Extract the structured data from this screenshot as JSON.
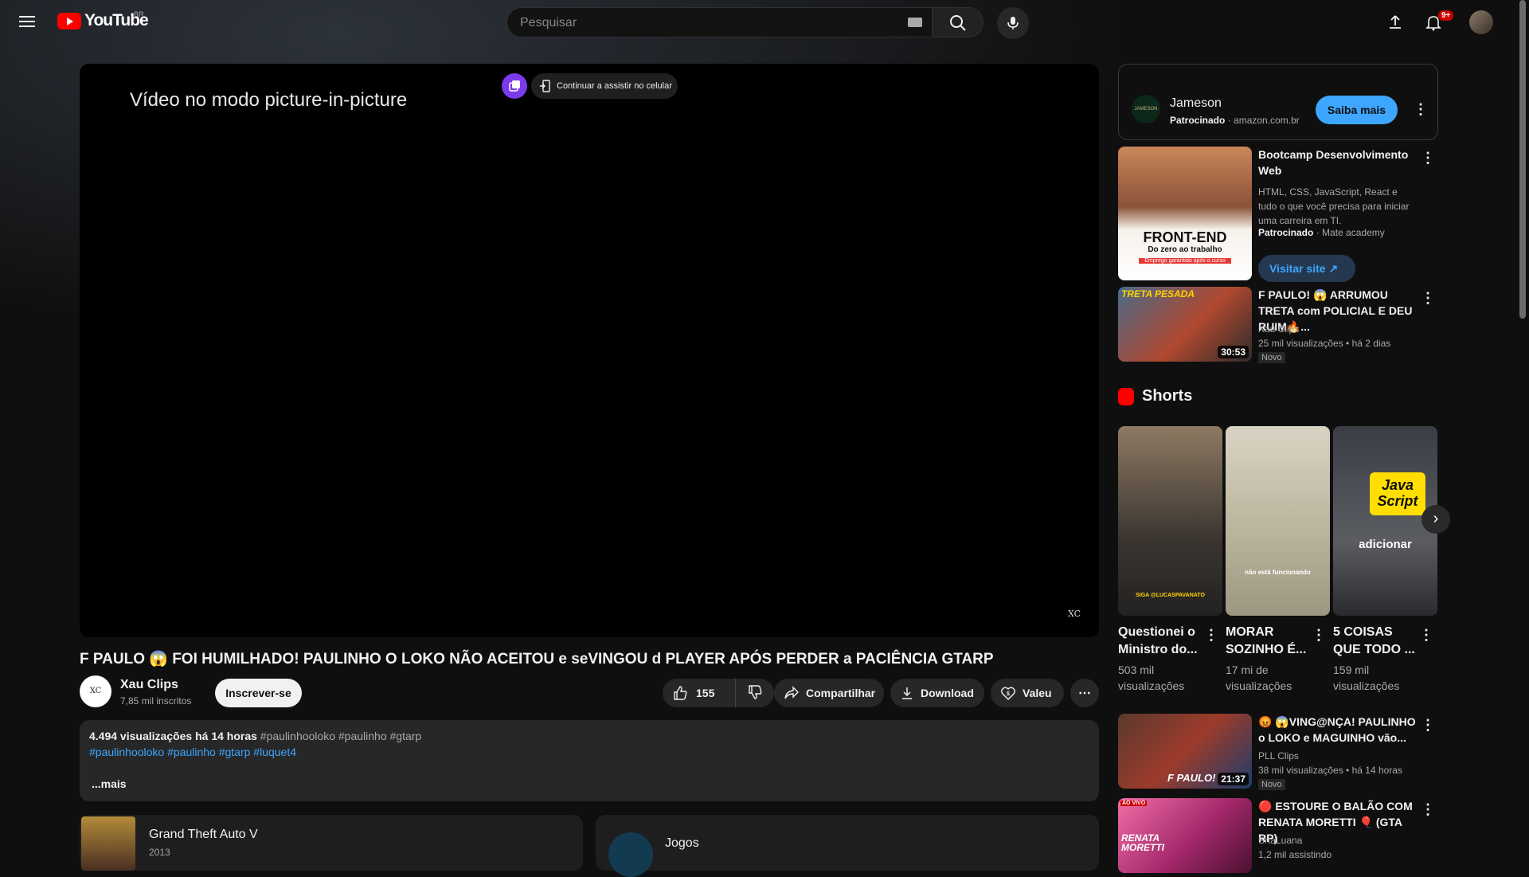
{
  "header": {
    "logo_text": "YouTube",
    "region": "BR",
    "search_placeholder": "Pesquisar",
    "notif_count": "9+"
  },
  "player": {
    "pip_message": "Vídeo no modo picture-in-picture",
    "continue_label": "Continuar a assistir no celular",
    "watermark": "XC"
  },
  "video": {
    "title": "F PAULO 😱 FOI HUMILHADO! PAULINHO O LOKO NÃO ACEITOU e seVINGOU d PLAYER APÓS PERDER a PACIÊNCIA GTARP",
    "channel": "Xau Clips",
    "channel_initials": "XC",
    "subscribers": "7,85 mil inscritos",
    "subscribe_label": "Inscrever-se",
    "likes": "155",
    "share_label": "Compartilhar",
    "download_label": "Download",
    "valeu_label": "Valeu",
    "views_time": "4.494 visualizações  há 14 horas",
    "tags_inline": "#paulinhooloko #paulinho #gtarp",
    "tags_line2": "#paulinhooloko #paulinho #gtarp #luquet4",
    "more_label": "...mais"
  },
  "cards": [
    {
      "title": "Grand Theft Auto V",
      "sub": "2013"
    },
    {
      "title": "Jogos"
    }
  ],
  "ad": {
    "name": "Jameson",
    "logo_text": "JAMESON",
    "sponsored": "Patrocinado",
    "domain": "· amazon.com.br",
    "cta": "Saiba mais"
  },
  "recs": [
    {
      "title": "Bootcamp Desenvolvimento Web",
      "desc": "HTML, CSS, JavaScript, React e tudo o que você precisa para iniciar uma carreira em TI.",
      "sponsored": "Patrocinado",
      "advertiser": "· Mate academy",
      "cta": "Visitar site",
      "thumb_big": "FRONT-END",
      "thumb_sub": "Do zero ao trabalho",
      "thumb_tag": "Emprego garantido após o curso"
    },
    {
      "title": "F PAULO! 😱 ARRUMOU TRETA com POLICIAL E DEU RUIM🔥...",
      "channel": "Xau Clips",
      "meta": "25 mil visualizações  • há 2 dias",
      "badge": "Novo",
      "duration": "30:53",
      "thumb_text": "TRETA PESADA"
    },
    {
      "title": "😡 😱VING@NÇA! PAULINHO o LOKO e MAGUINHO vão...",
      "channel": "PLL Clips",
      "meta": "38 mil visualizações  • há 14 horas",
      "badge": "Novo",
      "duration": "21:37",
      "thumb_text": "F PAULO!"
    },
    {
      "title": "🔴 ESTOURE O BALÃO COM RENATA MORETTI 🎈 (GTA RP)",
      "channel": "SrtaLuana",
      "meta": "1,2 mil assistindo",
      "thumb_text": "RENATA MORETTI",
      "live": "AO VIVO"
    }
  ],
  "shorts": {
    "heading": "Shorts",
    "items": [
      {
        "title": "Questionei o Ministro do...",
        "views": "503 mil visualizações",
        "caption": "SIGA @LUCASPAVANATO"
      },
      {
        "title": "MORAR SOZINHO É...",
        "views": "17 mi de visualizações",
        "caption": "não está funcionando"
      },
      {
        "title": "5 COISAS QUE TODO ...",
        "views": "159 mil visualizações",
        "caption": "adicionar",
        "badge": "Java Script"
      }
    ]
  }
}
